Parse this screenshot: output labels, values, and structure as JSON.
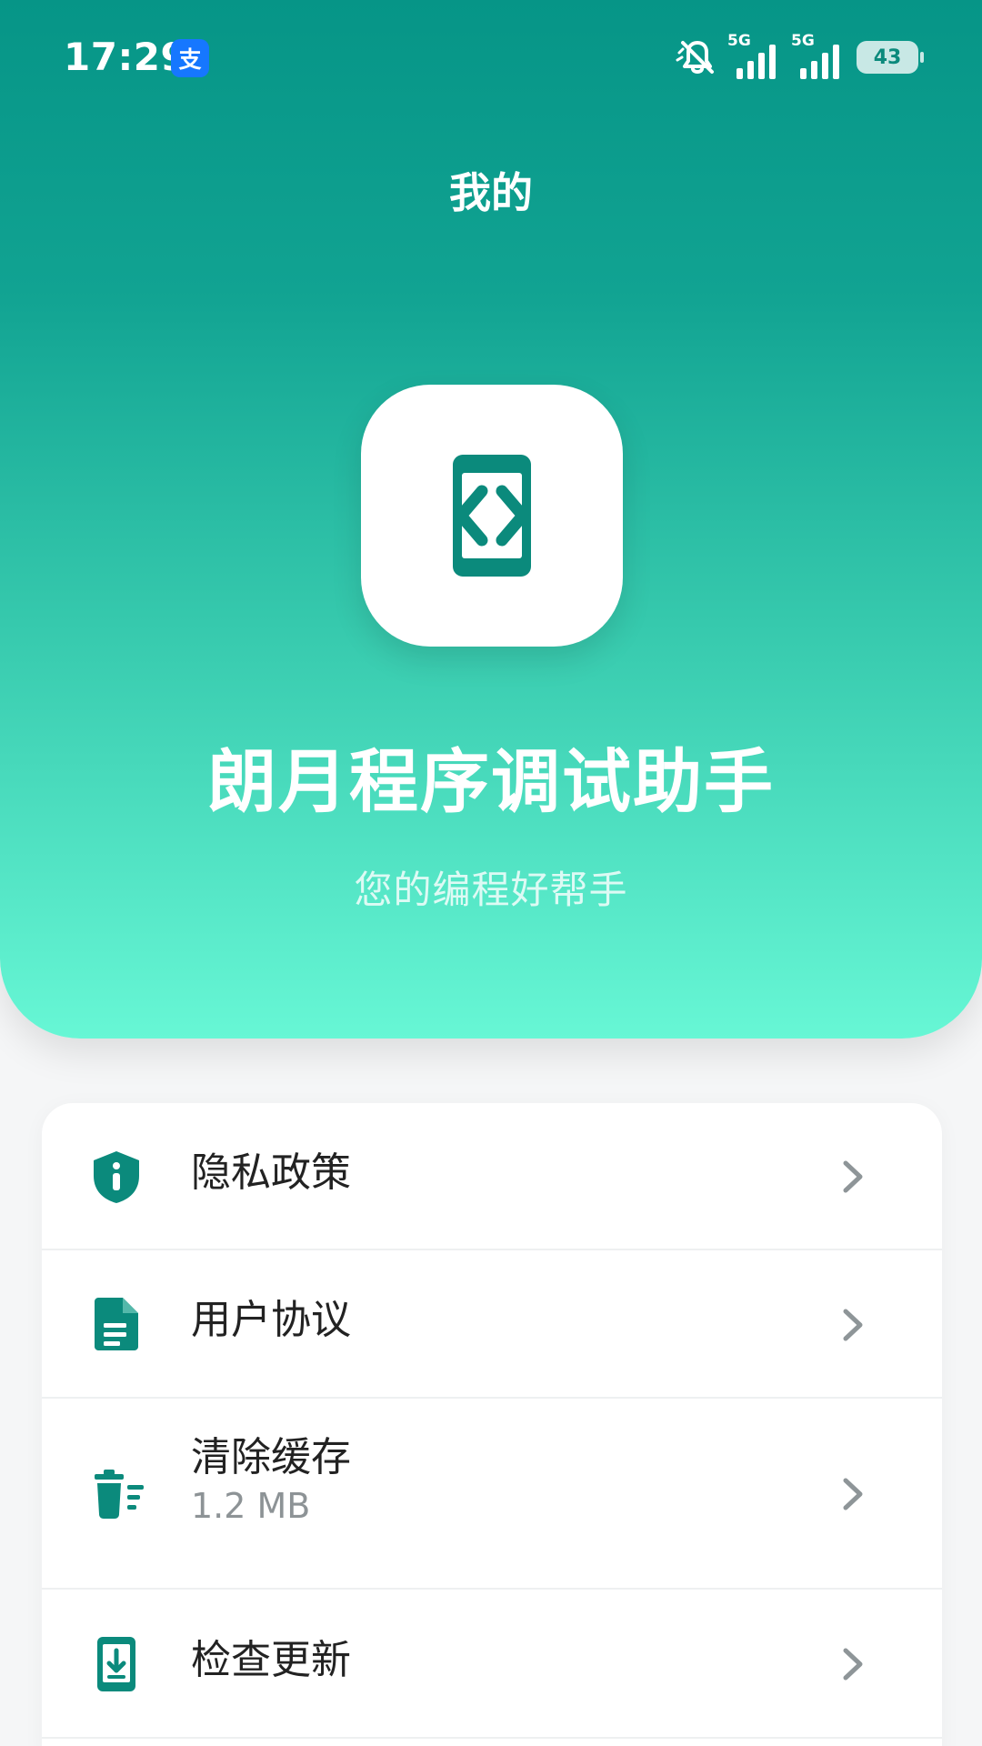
{
  "status_bar": {
    "time": "17:29",
    "app_badge_text": "支",
    "network_1": "5G",
    "network_2": "5G",
    "battery_level": "43"
  },
  "header": {
    "title": "我的",
    "app_name": "朗月程序调试助手",
    "app_subtitle": "您的编程好帮手"
  },
  "menu": {
    "items": [
      {
        "label": "隐私政策",
        "icon": "shield-info-icon"
      },
      {
        "label": "用户协议",
        "icon": "document-icon"
      },
      {
        "label": "清除缓存",
        "sublabel": "1.2 MB",
        "icon": "trash-icon"
      },
      {
        "label": "检查更新",
        "icon": "phone-download-icon"
      }
    ]
  },
  "colors": {
    "accent": "#0B8A7C",
    "header_top": "#069587",
    "header_bottom": "#67F7D5"
  }
}
